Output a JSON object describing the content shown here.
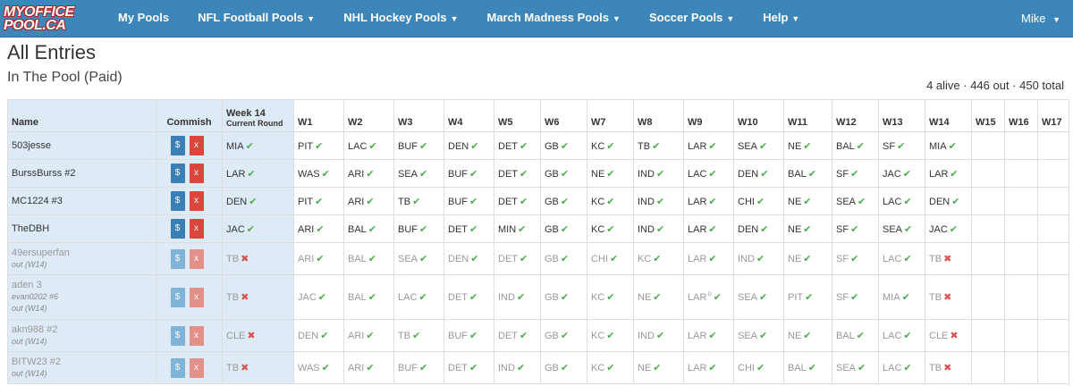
{
  "navbar": {
    "logo_line1": "MYOFFICE",
    "logo_line2": "POOL.CA",
    "items": [
      {
        "label": "My Pools",
        "dropdown": false
      },
      {
        "label": "NFL Football Pools",
        "dropdown": true
      },
      {
        "label": "NHL Hockey Pools",
        "dropdown": true
      },
      {
        "label": "March Madness Pools",
        "dropdown": true
      },
      {
        "label": "Soccer Pools",
        "dropdown": true
      },
      {
        "label": "Help",
        "dropdown": true
      }
    ],
    "user": "Mike"
  },
  "page": {
    "title": "All Entries",
    "subtitle": "In The Pool (Paid)",
    "summary": "4 alive · 446 out · 450 total"
  },
  "table": {
    "headers": {
      "name": "Name",
      "commish": "Commish",
      "current_week": "Week 14",
      "current_round": "Current Round",
      "weeks": [
        "W1",
        "W2",
        "W3",
        "W4",
        "W5",
        "W6",
        "W7",
        "W8",
        "W9",
        "W10",
        "W11",
        "W12",
        "W13",
        "W14",
        "W15",
        "W16",
        "W17"
      ]
    },
    "commish_buttons": {
      "pay": "$",
      "remove": "x"
    },
    "rows": [
      {
        "name": "503jesse",
        "out": false,
        "current": {
          "team": "MIA",
          "status": "win"
        },
        "picks": [
          [
            "PIT",
            "win"
          ],
          [
            "LAC",
            "win"
          ],
          [
            "BUF",
            "win"
          ],
          [
            "DEN",
            "win"
          ],
          [
            "DET",
            "win"
          ],
          [
            "GB",
            "win"
          ],
          [
            "KC",
            "win"
          ],
          [
            "TB",
            "win"
          ],
          [
            "LAR",
            "win"
          ],
          [
            "SEA",
            "win"
          ],
          [
            "NE",
            "win"
          ],
          [
            "BAL",
            "win"
          ],
          [
            "SF",
            "win"
          ],
          [
            "MIA",
            "win"
          ],
          [
            "",
            ""
          ],
          [
            "",
            ""
          ],
          [
            "",
            ""
          ]
        ]
      },
      {
        "name": "BurssBurss #2",
        "out": false,
        "current": {
          "team": "LAR",
          "status": "win"
        },
        "picks": [
          [
            "WAS",
            "win"
          ],
          [
            "ARI",
            "win"
          ],
          [
            "SEA",
            "win"
          ],
          [
            "BUF",
            "win"
          ],
          [
            "DET",
            "win"
          ],
          [
            "GB",
            "win"
          ],
          [
            "NE",
            "win"
          ],
          [
            "IND",
            "win"
          ],
          [
            "LAC",
            "win"
          ],
          [
            "DEN",
            "win"
          ],
          [
            "BAL",
            "win"
          ],
          [
            "SF",
            "win"
          ],
          [
            "JAC",
            "win"
          ],
          [
            "LAR",
            "win"
          ],
          [
            "",
            ""
          ],
          [
            "",
            ""
          ],
          [
            "",
            ""
          ]
        ]
      },
      {
        "name": "MC1224 #3",
        "out": false,
        "current": {
          "team": "DEN",
          "status": "win"
        },
        "picks": [
          [
            "PIT",
            "win"
          ],
          [
            "ARI",
            "win"
          ],
          [
            "TB",
            "win"
          ],
          [
            "BUF",
            "win"
          ],
          [
            "DET",
            "win"
          ],
          [
            "GB",
            "win"
          ],
          [
            "KC",
            "win"
          ],
          [
            "IND",
            "win"
          ],
          [
            "LAR",
            "win"
          ],
          [
            "CHI",
            "win"
          ],
          [
            "NE",
            "win"
          ],
          [
            "SEA",
            "win"
          ],
          [
            "LAC",
            "win"
          ],
          [
            "DEN",
            "win"
          ],
          [
            "",
            ""
          ],
          [
            "",
            ""
          ],
          [
            "",
            ""
          ]
        ]
      },
      {
        "name": "TheDBH",
        "out": false,
        "current": {
          "team": "JAC",
          "status": "win"
        },
        "picks": [
          [
            "ARI",
            "win"
          ],
          [
            "BAL",
            "win"
          ],
          [
            "BUF",
            "win"
          ],
          [
            "DET",
            "win"
          ],
          [
            "MIN",
            "win"
          ],
          [
            "GB",
            "win"
          ],
          [
            "KC",
            "win"
          ],
          [
            "IND",
            "win"
          ],
          [
            "LAR",
            "win"
          ],
          [
            "DEN",
            "win"
          ],
          [
            "NE",
            "win"
          ],
          [
            "SF",
            "win"
          ],
          [
            "SEA",
            "win"
          ],
          [
            "JAC",
            "win"
          ],
          [
            "",
            ""
          ],
          [
            "",
            ""
          ],
          [
            "",
            ""
          ]
        ]
      },
      {
        "name": "49ersuperfan",
        "out": true,
        "out_label": "out (W14)",
        "current": {
          "team": "TB",
          "status": "loss"
        },
        "picks": [
          [
            "ARI",
            "win"
          ],
          [
            "BAL",
            "win"
          ],
          [
            "SEA",
            "win"
          ],
          [
            "DEN",
            "win"
          ],
          [
            "DET",
            "win"
          ],
          [
            "GB",
            "win"
          ],
          [
            "CHI",
            "win"
          ],
          [
            "KC",
            "win"
          ],
          [
            "LAR",
            "win"
          ],
          [
            "IND",
            "win"
          ],
          [
            "NE",
            "win"
          ],
          [
            "SF",
            "win"
          ],
          [
            "LAC",
            "win"
          ],
          [
            "TB",
            "loss"
          ],
          [
            "",
            ""
          ],
          [
            "",
            ""
          ],
          [
            "",
            ""
          ]
        ]
      },
      {
        "name": "aden 3",
        "secondary": "evan0202 #6",
        "out": true,
        "out_label": "out (W14)",
        "current": {
          "team": "TB",
          "status": "loss"
        },
        "picks": [
          [
            "JAC",
            "win"
          ],
          [
            "BAL",
            "win"
          ],
          [
            "LAC",
            "win"
          ],
          [
            "DET",
            "win"
          ],
          [
            "IND",
            "win"
          ],
          [
            "GB",
            "win"
          ],
          [
            "KC",
            "win"
          ],
          [
            "NE",
            "win"
          ],
          [
            "LAR",
            "win",
            "D"
          ],
          [
            "SEA",
            "win"
          ],
          [
            "PIT",
            "win"
          ],
          [
            "SF",
            "win"
          ],
          [
            "MIA",
            "win"
          ],
          [
            "TB",
            "loss"
          ],
          [
            "",
            ""
          ],
          [
            "",
            ""
          ],
          [
            "",
            ""
          ]
        ]
      },
      {
        "name": "akn988 #2",
        "out": true,
        "out_label": "out (W14)",
        "current": {
          "team": "CLE",
          "status": "loss"
        },
        "picks": [
          [
            "DEN",
            "win"
          ],
          [
            "ARI",
            "win"
          ],
          [
            "TB",
            "win"
          ],
          [
            "BUF",
            "win"
          ],
          [
            "DET",
            "win"
          ],
          [
            "GB",
            "win"
          ],
          [
            "KC",
            "win"
          ],
          [
            "IND",
            "win"
          ],
          [
            "LAR",
            "win"
          ],
          [
            "SEA",
            "win"
          ],
          [
            "NE",
            "win"
          ],
          [
            "BAL",
            "win"
          ],
          [
            "LAC",
            "win"
          ],
          [
            "CLE",
            "loss"
          ],
          [
            "",
            ""
          ],
          [
            "",
            ""
          ],
          [
            "",
            ""
          ]
        ]
      },
      {
        "name": "BITW23 #2",
        "out": true,
        "out_label": "out (W14)",
        "current": {
          "team": "TB",
          "status": "loss"
        },
        "picks": [
          [
            "WAS",
            "win"
          ],
          [
            "ARI",
            "win"
          ],
          [
            "BUF",
            "win"
          ],
          [
            "DET",
            "win"
          ],
          [
            "IND",
            "win"
          ],
          [
            "GB",
            "win"
          ],
          [
            "KC",
            "win"
          ],
          [
            "NE",
            "win"
          ],
          [
            "LAR",
            "win"
          ],
          [
            "CHI",
            "win"
          ],
          [
            "BAL",
            "win"
          ],
          [
            "SEA",
            "win"
          ],
          [
            "LAC",
            "win"
          ],
          [
            "TB",
            "loss"
          ],
          [
            "",
            ""
          ],
          [
            "",
            ""
          ],
          [
            "",
            ""
          ]
        ]
      }
    ]
  },
  "icons": {
    "win": "checkmark-icon",
    "loss": "x-mark-icon"
  },
  "colors": {
    "navbar": "#3c86b9",
    "win": "#4cae4c",
    "loss": "#d9534f",
    "shade": "#deeaf5",
    "pay_button": "#3a7fb5",
    "remove_button": "#d9463a"
  }
}
